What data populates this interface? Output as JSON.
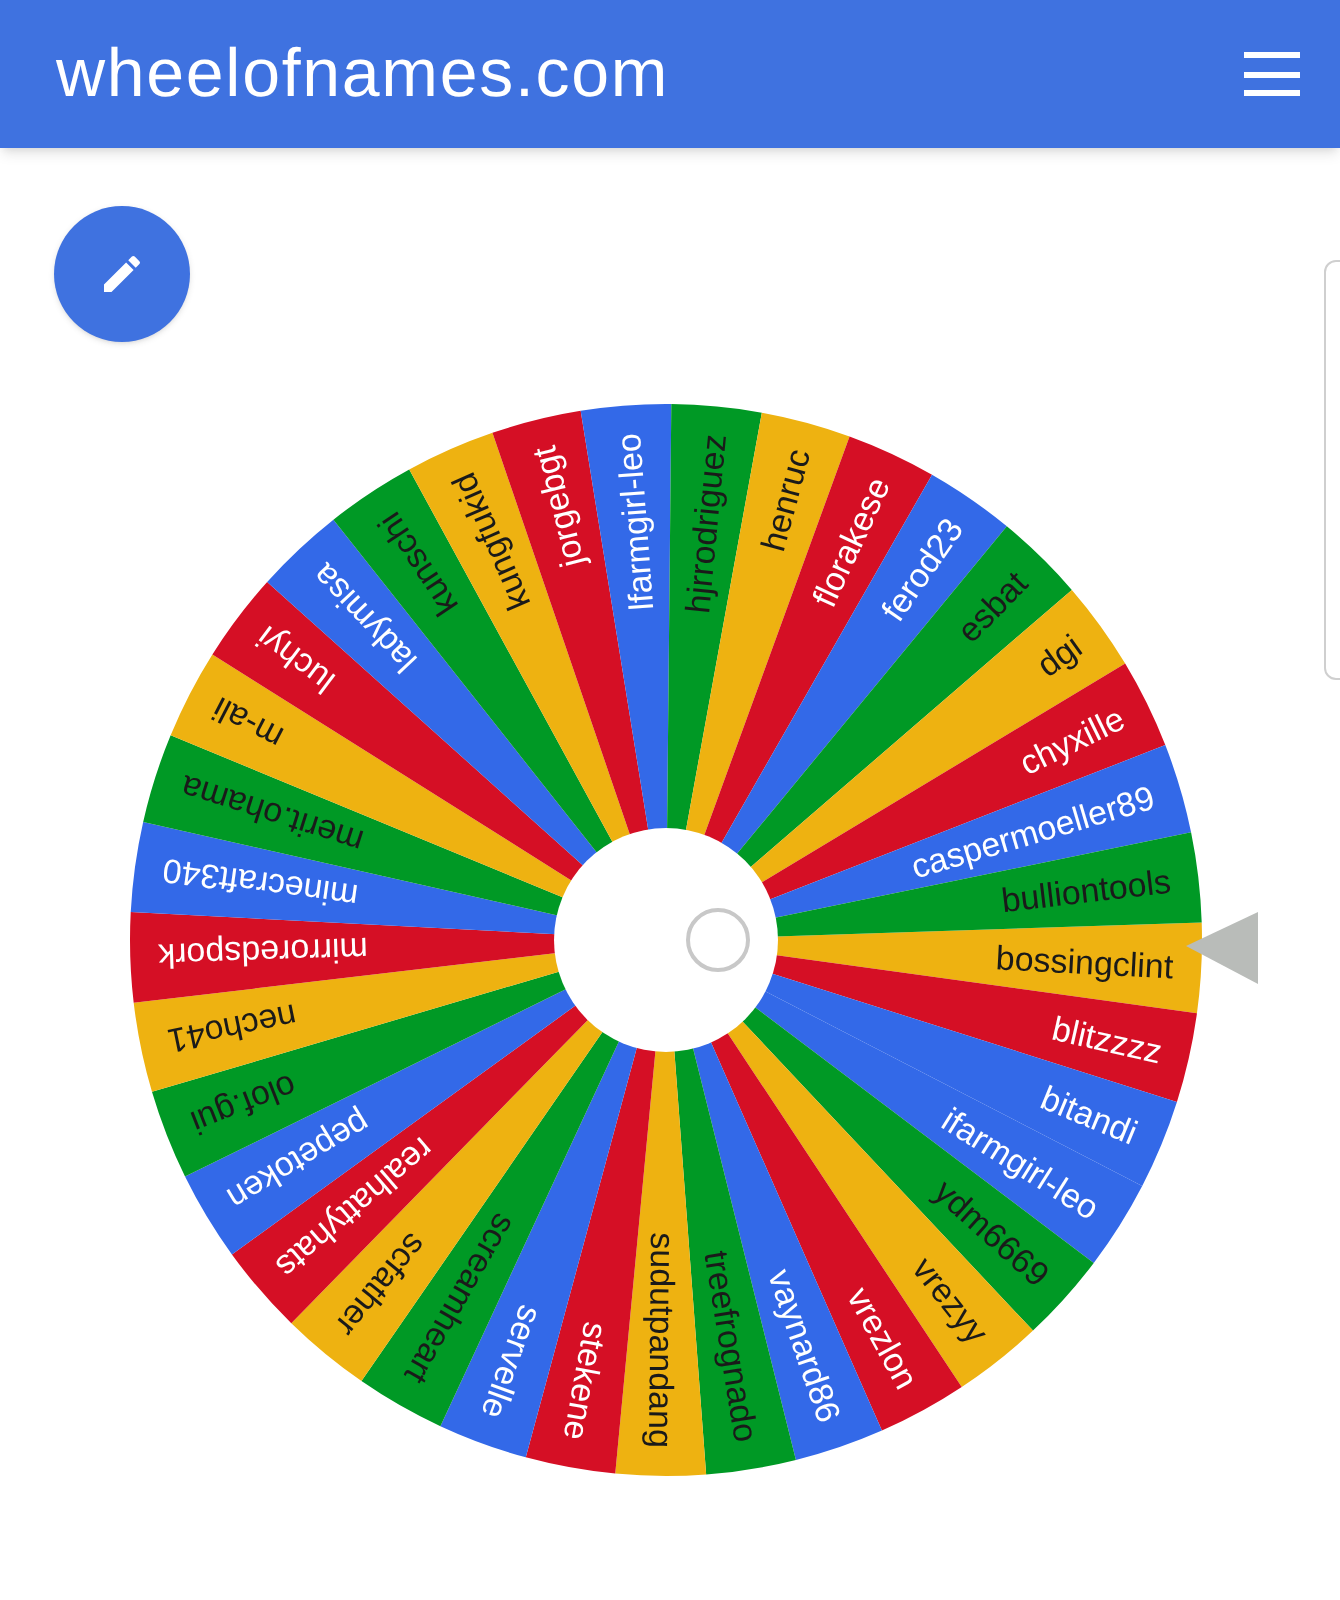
{
  "header": {
    "title": "wheelofnames.com"
  },
  "wheel": {
    "segments": [
      {
        "label": "bossingclint",
        "color": "#eeb211"
      },
      {
        "label": "blitzzzz",
        "color": "#d50f25"
      },
      {
        "label": "bitandi",
        "color": "#3369e8"
      },
      {
        "label": "ifarmgirl-leo",
        "color": "#3369e8"
      },
      {
        "label": "ydm6669",
        "color": "#009925"
      },
      {
        "label": "vrezyy",
        "color": "#eeb211"
      },
      {
        "label": "vrezlon",
        "color": "#d50f25"
      },
      {
        "label": "vaynard86",
        "color": "#3369e8"
      },
      {
        "label": "treefrognado",
        "color": "#009925"
      },
      {
        "label": "sudutpandang",
        "color": "#eeb211"
      },
      {
        "label": "stekene",
        "color": "#d50f25"
      },
      {
        "label": "servelle",
        "color": "#3369e8"
      },
      {
        "label": "screamheart",
        "color": "#009925"
      },
      {
        "label": "scfather",
        "color": "#eeb211"
      },
      {
        "label": "realhattyhats",
        "color": "#d50f25"
      },
      {
        "label": "pepetoken",
        "color": "#3369e8"
      },
      {
        "label": "olof.gui",
        "color": "#009925"
      },
      {
        "label": "necho41",
        "color": "#eeb211"
      },
      {
        "label": "mirroredspork",
        "color": "#d50f25"
      },
      {
        "label": "minecraft340",
        "color": "#3369e8"
      },
      {
        "label": "merit.ohama",
        "color": "#009925"
      },
      {
        "label": "m-ali",
        "color": "#eeb211"
      },
      {
        "label": "luchyi",
        "color": "#d50f25"
      },
      {
        "label": "ladymisa",
        "color": "#3369e8"
      },
      {
        "label": "kunschi",
        "color": "#009925"
      },
      {
        "label": "kungfukid",
        "color": "#eeb211"
      },
      {
        "label": "jorgebgt",
        "color": "#d50f25"
      },
      {
        "label": "lfarmgirl-leo",
        "color": "#3369e8"
      },
      {
        "label": "hjrrodriguez",
        "color": "#009925"
      },
      {
        "label": "henruc",
        "color": "#eeb211"
      },
      {
        "label": "florakese",
        "color": "#d50f25"
      },
      {
        "label": "ferod23",
        "color": "#3369e8"
      },
      {
        "label": "esbat",
        "color": "#009925"
      },
      {
        "label": "dgi",
        "color": "#eeb211"
      },
      {
        "label": "chyxille",
        "color": "#d50f25"
      },
      {
        "label": "caspermoeller89",
        "color": "#3369e8"
      },
      {
        "label": "bulliontools",
        "color": "#009925"
      }
    ]
  }
}
